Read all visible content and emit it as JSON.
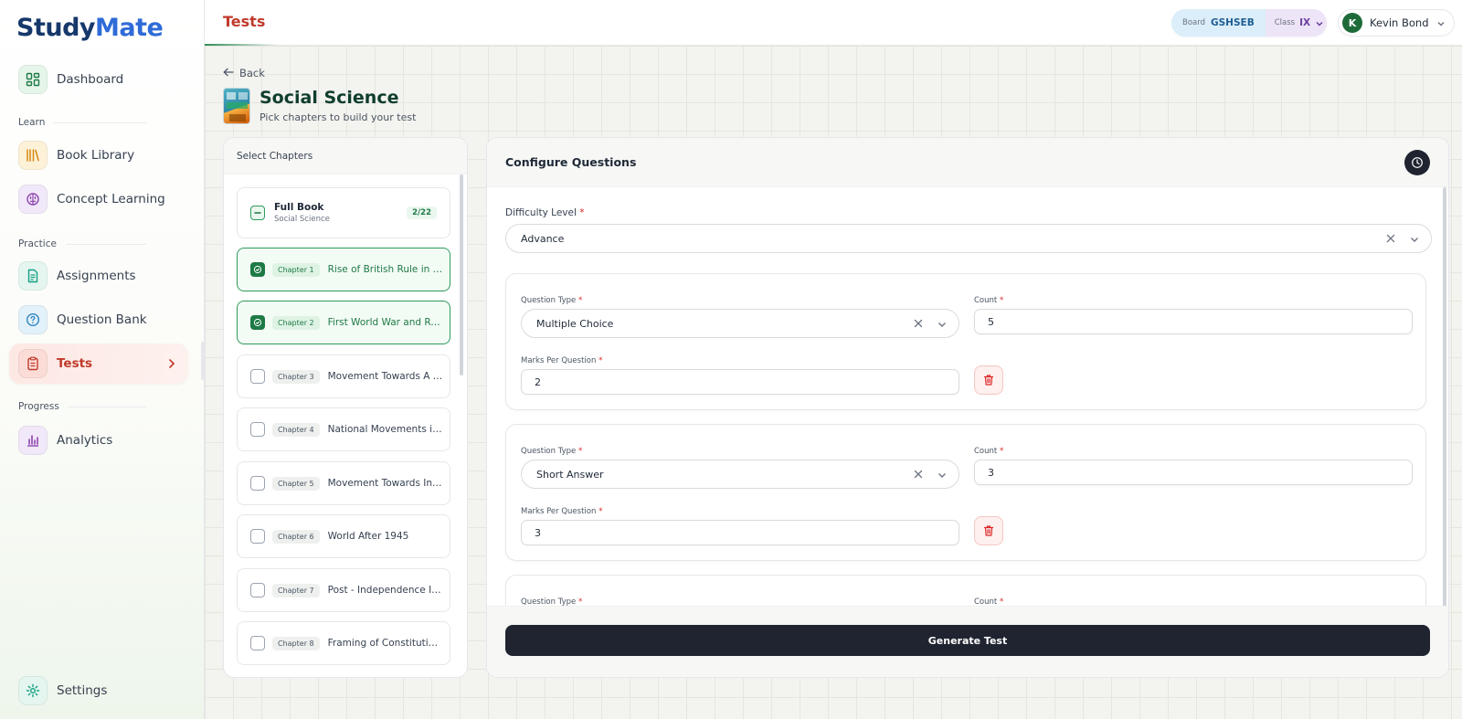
{
  "brand": {
    "name_part1": "Study",
    "name_part2": "Mate"
  },
  "sidebar": {
    "dashboard": "Dashboard",
    "sections": {
      "learn": "Learn",
      "practice": "Practice",
      "progress": "Progress"
    },
    "items": {
      "book_library": "Book Library",
      "concept_learning": "Concept Learning",
      "assignments": "Assignments",
      "question_bank": "Question Bank",
      "tests": "Tests",
      "analytics": "Analytics",
      "settings": "Settings"
    }
  },
  "header": {
    "title": "Tests",
    "board_label": "Board",
    "board_value": "GSHSEB",
    "class_label": "Class",
    "class_value": "IX",
    "user_initial": "K",
    "user_name": "Kevin Bond"
  },
  "page": {
    "back_label": "Back",
    "subject_title": "Social Science",
    "subject_subtitle": "Pick chapters to build your test"
  },
  "chapters": {
    "panel_title": "Select Chapters",
    "full_book": {
      "title": "Full Book",
      "subtitle": "Social Science",
      "count": "2/22"
    },
    "items": [
      {
        "badge": "Chapter 1",
        "title": "Rise of British Rule in India",
        "checked": true
      },
      {
        "badge": "Chapter 2",
        "title": "First World War and Russian Revolution",
        "checked": true
      },
      {
        "badge": "Chapter 3",
        "title": "Movement Towards A New Era",
        "checked": false
      },
      {
        "badge": "Chapter 4",
        "title": "National Movements in India",
        "checked": false
      },
      {
        "badge": "Chapter 5",
        "title": "Movement Towards Independence",
        "checked": false
      },
      {
        "badge": "Chapter 6",
        "title": "World After 1945",
        "checked": false
      },
      {
        "badge": "Chapter 7",
        "title": "Post - Independence India",
        "checked": false
      },
      {
        "badge": "Chapter 8",
        "title": "Framing of Constitution of India",
        "checked": false
      }
    ]
  },
  "config": {
    "title": "Configure Questions",
    "difficulty_label": "Difficulty Level",
    "difficulty_value": "Advance",
    "required_mark": "*",
    "question_type_label": "Question Type",
    "count_label": "Count",
    "marks_label": "Marks Per Question",
    "questions": [
      {
        "type": "Multiple Choice",
        "count": "5",
        "marks": "2"
      },
      {
        "type": "Short Answer",
        "count": "3",
        "marks": "3"
      }
    ],
    "generate_label": "Generate Test"
  },
  "colors": {
    "accent_red": "#c0392b",
    "accent_green": "#1e7a45",
    "dark_button": "#1f2430"
  }
}
